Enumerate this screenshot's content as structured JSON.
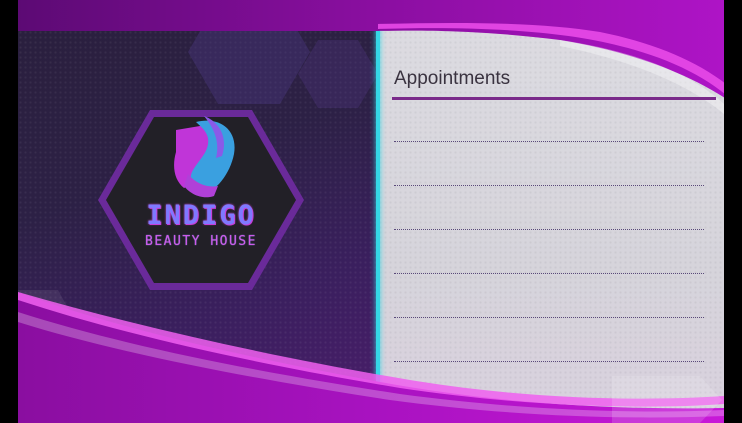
{
  "card": {
    "appointments_title": "Appointments",
    "line_count": 6
  },
  "logo": {
    "name": "INDIGO",
    "subtitle": "BEAUTY HOUSE",
    "icon": "woman-hair-shield-icon"
  },
  "colors": {
    "accent_magenta": "#c014d0",
    "accent_cyan": "#35d7e6",
    "dark_panel": "#2a1f3d",
    "title_rule": "#7a2a8a"
  }
}
